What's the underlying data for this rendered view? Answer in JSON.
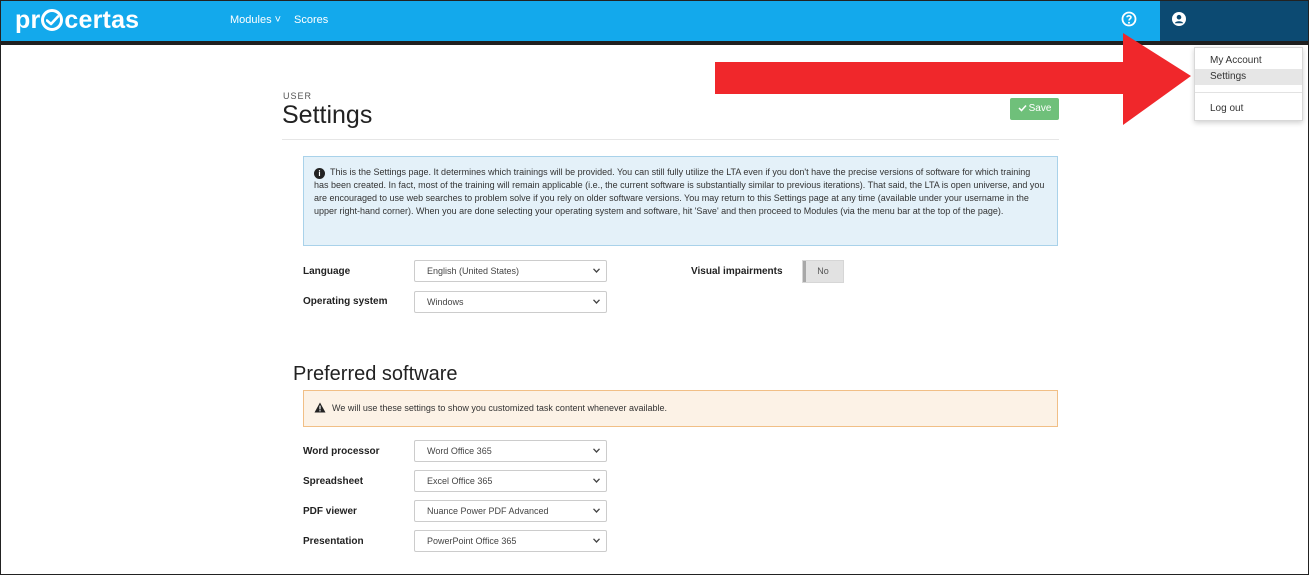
{
  "brand": {
    "logo_text_pre": "pr",
    "logo_text_post": "certas"
  },
  "nav": {
    "modules": "Modules ˅",
    "scores": "Scores"
  },
  "user_menu": {
    "items": [
      "My Account",
      "Settings",
      "Log out"
    ],
    "active": "Settings"
  },
  "page": {
    "kicker": "USER",
    "title": "Settings",
    "save_label": "Save"
  },
  "info_text": "This is the Settings page. It determines which trainings will be provided. You can still fully utilize the LTA even if you don't have the precise versions of software for which training has been created. In fact, most of the training will remain applicable (i.e., the current software is substantially similar to previous iterations). That said, the LTA is open universe, and you are encouraged to use web searches to problem solve if you rely on older software versions. You may return to this Settings page at any time (available under your username in the upper right-hand corner). When you are done selecting your operating system and software, hit 'Save' and then proceed to Modules (via the menu bar at the top of the page).",
  "settings": {
    "language": {
      "label": "Language",
      "value": "English (United States)"
    },
    "os": {
      "label": "Operating system",
      "value": "Windows"
    },
    "visual": {
      "label": "Visual impairments",
      "value": "No"
    }
  },
  "preferred": {
    "title": "Preferred software",
    "warning": "We will use these settings to show you customized task content whenever available.",
    "word": {
      "label": "Word processor",
      "value": "Word Office 365"
    },
    "spreadsheet": {
      "label": "Spreadsheet",
      "value": "Excel Office 365"
    },
    "pdf": {
      "label": "PDF viewer",
      "value": "Nuance Power PDF Advanced"
    },
    "presentation": {
      "label": "Presentation",
      "value": "PowerPoint Office 365"
    }
  },
  "colors": {
    "topbar": "#13a9ec",
    "user_area": "#0c4a72",
    "save_button": "#6fc07a",
    "annotation_arrow": "#f0272b"
  },
  "icons": [
    "checkmark-circle-logo-icon",
    "help-icon",
    "user-icon",
    "check-icon",
    "info-icon",
    "warning-icon",
    "chevron-down-icon",
    "red-arrow-annotation"
  ]
}
